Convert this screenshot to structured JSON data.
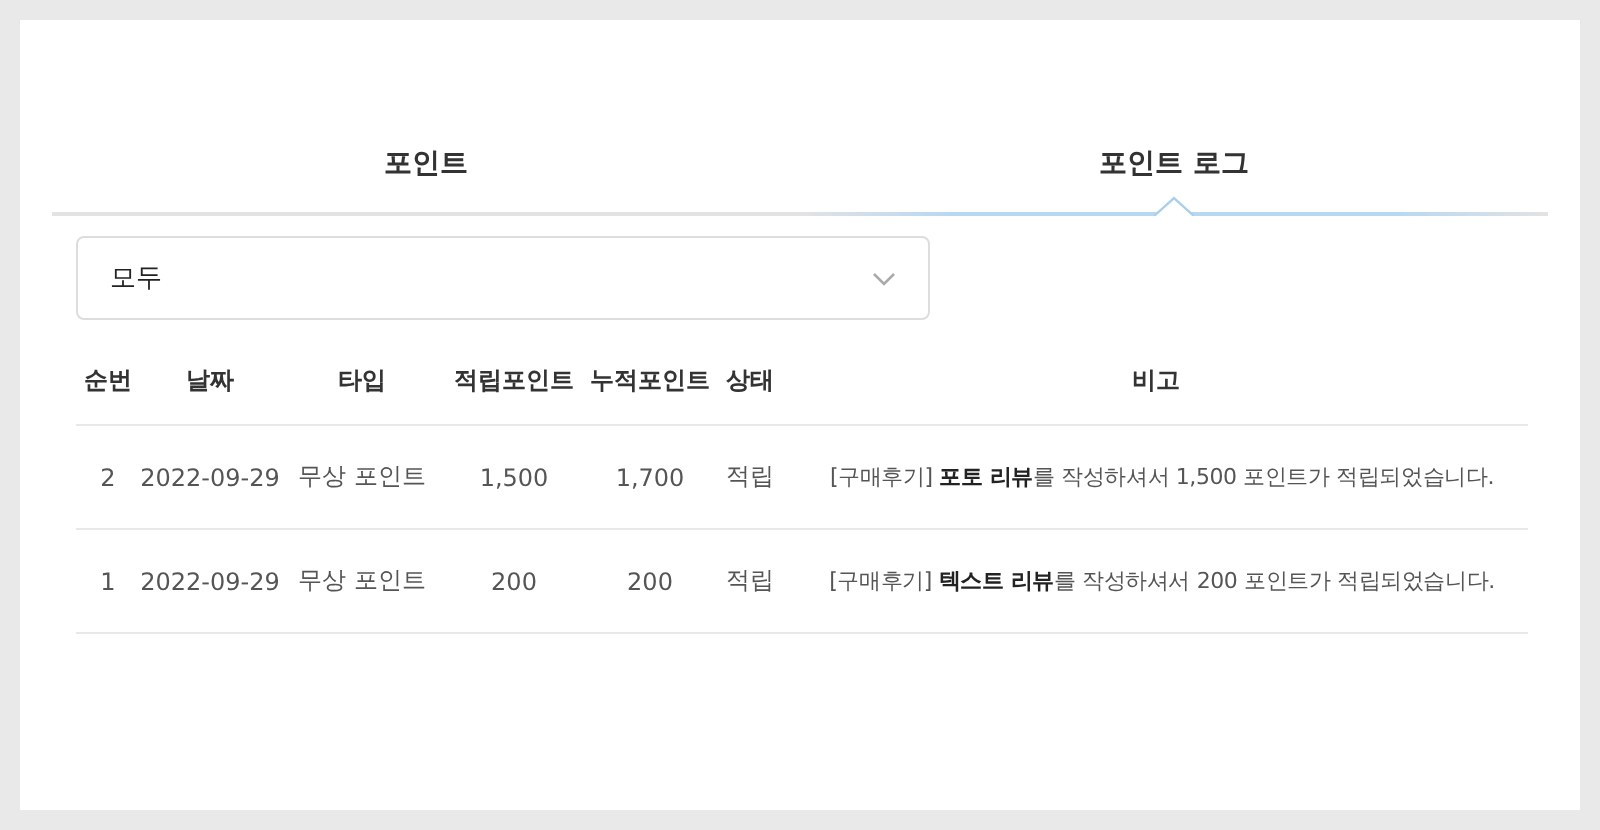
{
  "tabs": [
    {
      "label": "포인트",
      "selected": false
    },
    {
      "label": "포인트 로그",
      "selected": true
    }
  ],
  "filter": {
    "value": "모두"
  },
  "table": {
    "columns": [
      "순번",
      "날짜",
      "타입",
      "적립포인트",
      "누적포인트",
      "상태",
      "비고"
    ],
    "rows": [
      [
        "2",
        "2022-09-29",
        "무상 포인트",
        "1,500",
        "1,700",
        "적립",
        "[구매후기] **포토 리뷰**를 작성하셔서 1,500 포인트가 적립되었습니다."
      ],
      [
        "1",
        "2022-09-29",
        "무상 포인트",
        "200",
        "200",
        "적립",
        "[구매후기] **텍스트 리뷰**를 작성하셔서 200 포인트가 적립되었습니다."
      ]
    ]
  }
}
